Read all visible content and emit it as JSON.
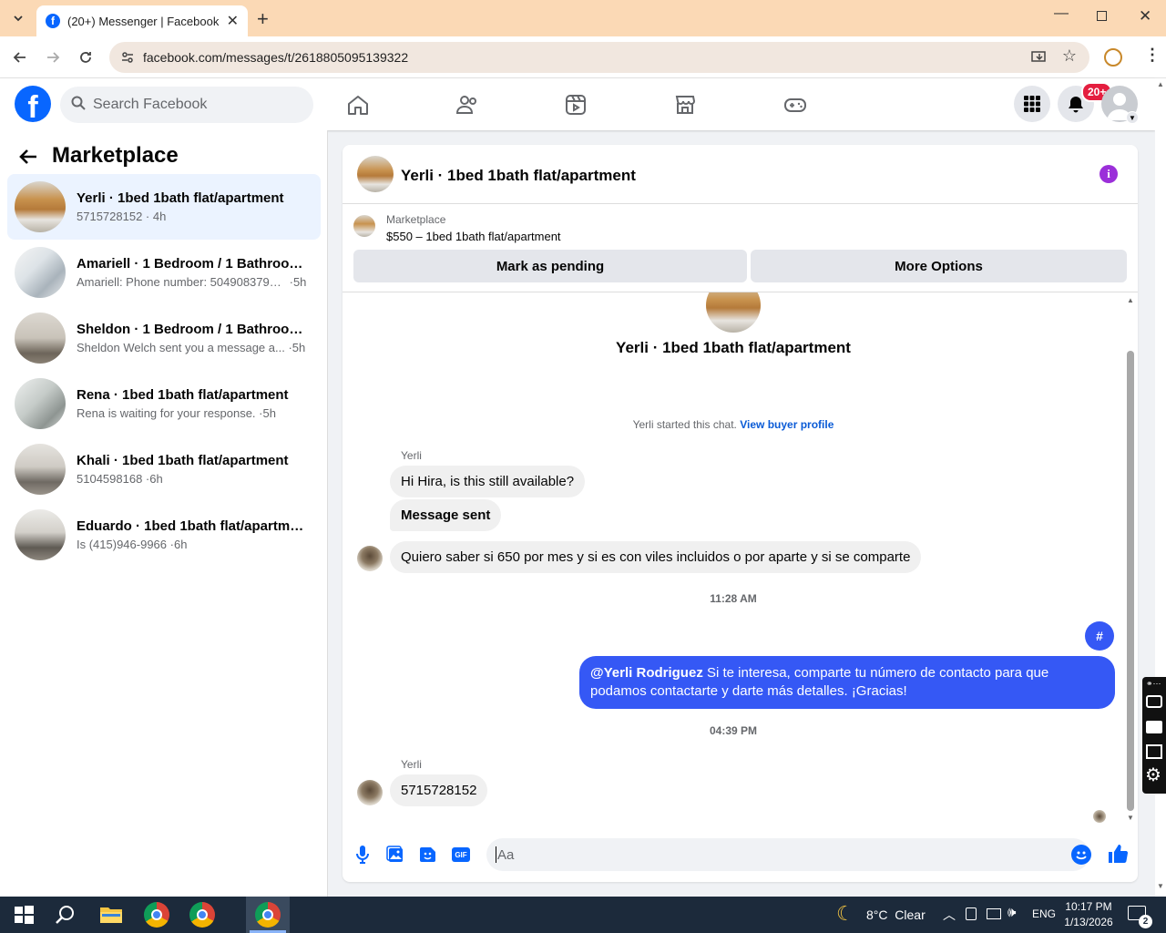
{
  "browser": {
    "tab_title": "(20+) Messenger | Facebook",
    "url": "facebook.com/messages/t/2618805095139322"
  },
  "header": {
    "search_placeholder": "Search Facebook",
    "notification_badge": "20+"
  },
  "sidebar": {
    "title": "Marketplace",
    "conversations": [
      {
        "title": "Yerli · 1bed 1bath flat/apartment",
        "preview": "5715728152",
        "time": "4h"
      },
      {
        "title": "Amariell · 1 Bedroom / 1 Bathroom...",
        "preview": "Amariell: Phone number: 5049083793 ...",
        "time": "5h"
      },
      {
        "title": "Sheldon · 1 Bedroom / 1 Bathroom...",
        "preview": "Sheldon Welch sent you a message a...",
        "time": "5h"
      },
      {
        "title": "Rena · 1bed 1bath flat/apartment",
        "preview": "Rena is waiting for your response.",
        "time": "5h"
      },
      {
        "title": "Khali · 1bed 1bath flat/apartment",
        "preview": "5104598168",
        "time": "6h"
      },
      {
        "title": "Eduardo · 1bed 1bath flat/apartment",
        "preview": "Is (415)946-9966",
        "time": "6h"
      }
    ]
  },
  "chat": {
    "title": "Yerli · 1bed 1bath flat/apartment",
    "listing_label": "Marketplace",
    "listing_price": "$550 – 1bed 1bath flat/apartment",
    "mark_pending": "Mark as pending",
    "more_options": "More Options",
    "intro_title": "Yerli · 1bed 1bath flat/apartment",
    "started_text": "Yerli started this chat.",
    "view_profile": "View buyer profile",
    "sender_name": "Yerli",
    "msg1": "Hi Hira, is this still available?",
    "msg2": "Message sent",
    "msg3": "Quiero saber si 650 por mes y si es con viles incluidos o por aparte y si se comparte",
    "time1": "11:28 AM",
    "hash_msg": "#",
    "mention": "@Yerli Rodriguez",
    "reply": " Si te interesa, comparte tu número de contacto para que podamos contactarte y darte más detalles. ¡Gracias!",
    "time2": "04:39 PM",
    "sender_name2": "Yerli",
    "msg4": "5715728152",
    "input_placeholder": "Aa",
    "gif_label": "GIF"
  },
  "taskbar": {
    "weather": "8°C  Clear",
    "lang": "ENG",
    "time": "10:17 PM",
    "date": "1/13/2026",
    "notif_count": "2"
  },
  "colors": {
    "fb_blue": "#0866ff",
    "my_bubble": "#3558f5",
    "purple_info": "#9b2fd9",
    "tab_bar": "#fbd9b5",
    "taskbar": "#1c2a3b"
  }
}
